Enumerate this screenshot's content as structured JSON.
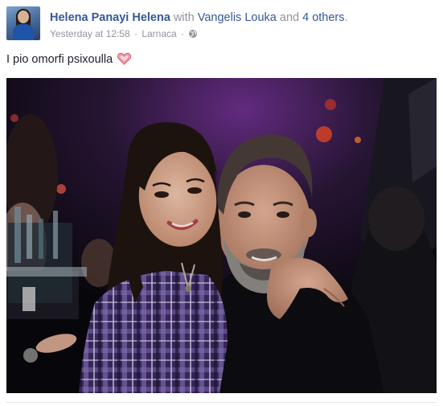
{
  "post": {
    "author": "Helena Panayi Helena",
    "with_word": " with ",
    "tagged_name": "Vangelis Louka",
    "and_word": " and ",
    "others": "4 others",
    "after_others": ".",
    "timestamp": "Yesterday at 12:58",
    "separator": "·",
    "location": "Larnaca",
    "privacy_icon": "globe-icon",
    "message": "I pio omorfi psixoulla",
    "emoji_icon": "heart-emoji-icon",
    "photo_icon": "photo-couple"
  },
  "colors": {
    "link": "#365899",
    "meta": "#90949c",
    "text": "#1d2129"
  }
}
